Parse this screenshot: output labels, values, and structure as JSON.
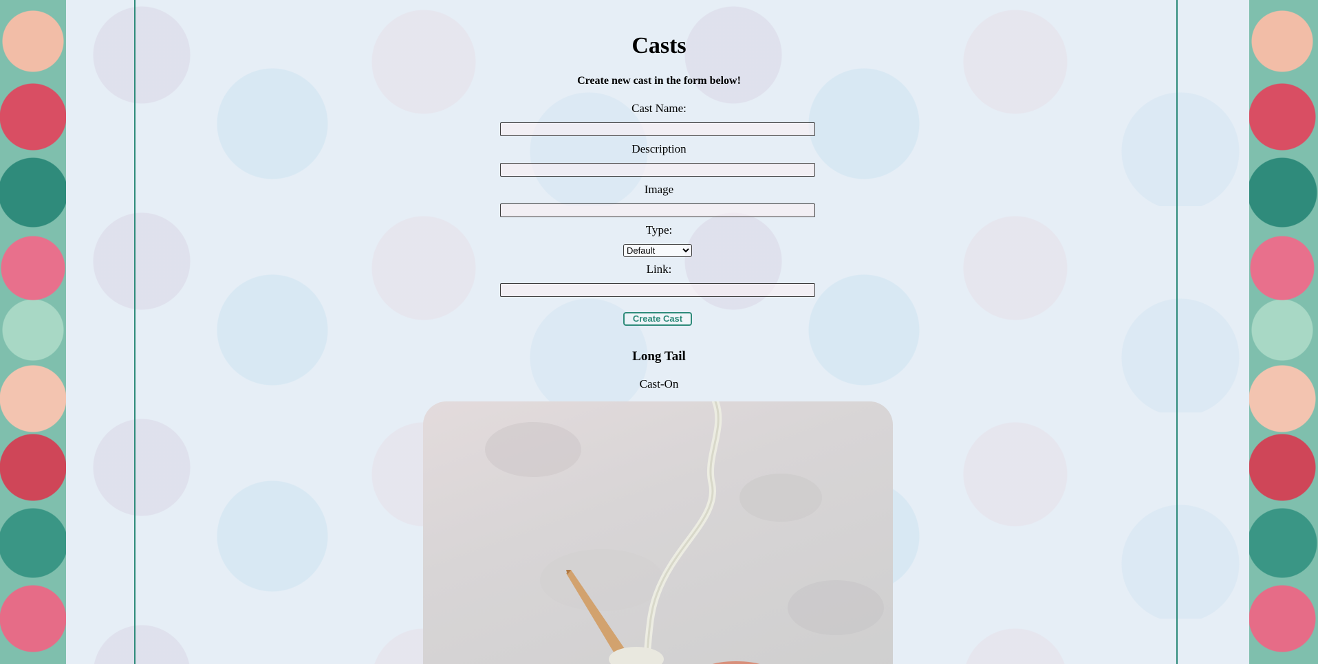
{
  "page": {
    "title": "Casts",
    "subtitle": "Create new cast in the form below!"
  },
  "form": {
    "cast_name_label": "Cast Name:",
    "cast_name_value": "",
    "description_label": "Description",
    "description_value": "",
    "image_label": "Image",
    "image_value": "",
    "type_label": "Type:",
    "type_selected": "Default",
    "link_label": "Link:",
    "link_value": "",
    "submit_label": "Create Cast"
  },
  "casts": [
    {
      "name": "Long Tail",
      "description": "Cast-On"
    }
  ],
  "colors": {
    "accent": "#2e8b7a",
    "content_background": "#e6eef6"
  },
  "icons": {
    "select": "chevron-down-icon"
  }
}
